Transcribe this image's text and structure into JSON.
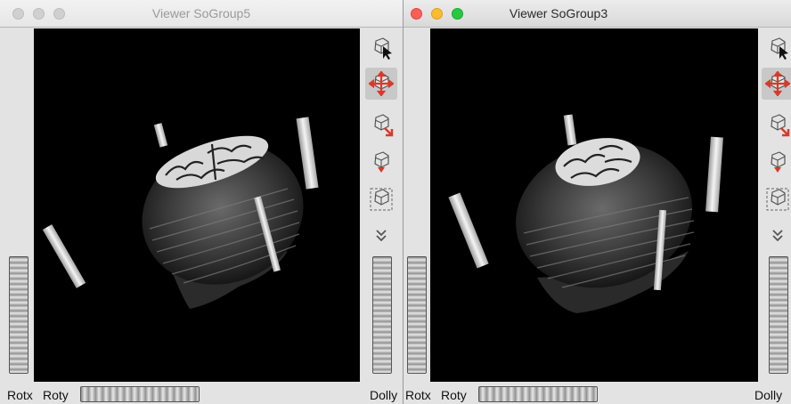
{
  "windows": [
    {
      "title": "Viewer SoGroup5",
      "focused": false,
      "tools": [
        "select-arrow-icon",
        "move-cross-icon",
        "home-view-icon",
        "set-home-icon",
        "view-all-icon",
        "more-chevron-icon"
      ],
      "labels": {
        "rotx": "Rotx",
        "roty": "Roty",
        "dolly": "Dolly"
      }
    },
    {
      "title": "Viewer SoGroup3",
      "focused": true,
      "tools": [
        "select-arrow-icon",
        "move-cross-icon",
        "home-view-icon",
        "set-home-icon",
        "view-all-icon",
        "more-chevron-icon"
      ],
      "labels": {
        "rotx": "Rotx",
        "roty": "Roty",
        "dolly": "Dolly"
      }
    }
  ],
  "colors": {
    "viewport_bg": "#000000",
    "close": "#fc5f57",
    "minimize": "#fdbc2e",
    "zoom": "#28c840",
    "tool_accent": "#d83a2a"
  }
}
